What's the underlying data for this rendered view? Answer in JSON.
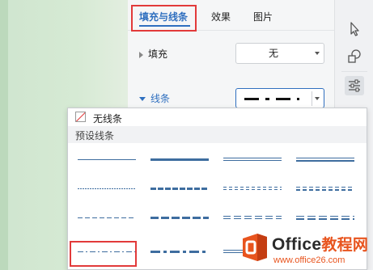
{
  "tabs": [
    {
      "label": "填充与线条",
      "active": true
    },
    {
      "label": "效果",
      "active": false
    },
    {
      "label": "图片",
      "active": false
    }
  ],
  "fill": {
    "label": "填充",
    "value": "无"
  },
  "line": {
    "label": "线条",
    "value_style": "dash-dot"
  },
  "dropdown": {
    "no_line_label": "无线条",
    "preset_header": "预设线条"
  },
  "right_toolbar": [
    {
      "icon": "cursor-icon"
    },
    {
      "icon": "shapes-icon"
    },
    {
      "icon": "settings-sliders-icon",
      "active": true
    }
  ],
  "brand": {
    "name_prefix": "Office",
    "name_suffix": "教程网",
    "url": "www.office26.com"
  },
  "colors": {
    "accent": "#2f6fbf",
    "line_preview": "#3e6d9f",
    "highlight_box": "#e23a3a",
    "brand_orange": "#e8541e"
  }
}
